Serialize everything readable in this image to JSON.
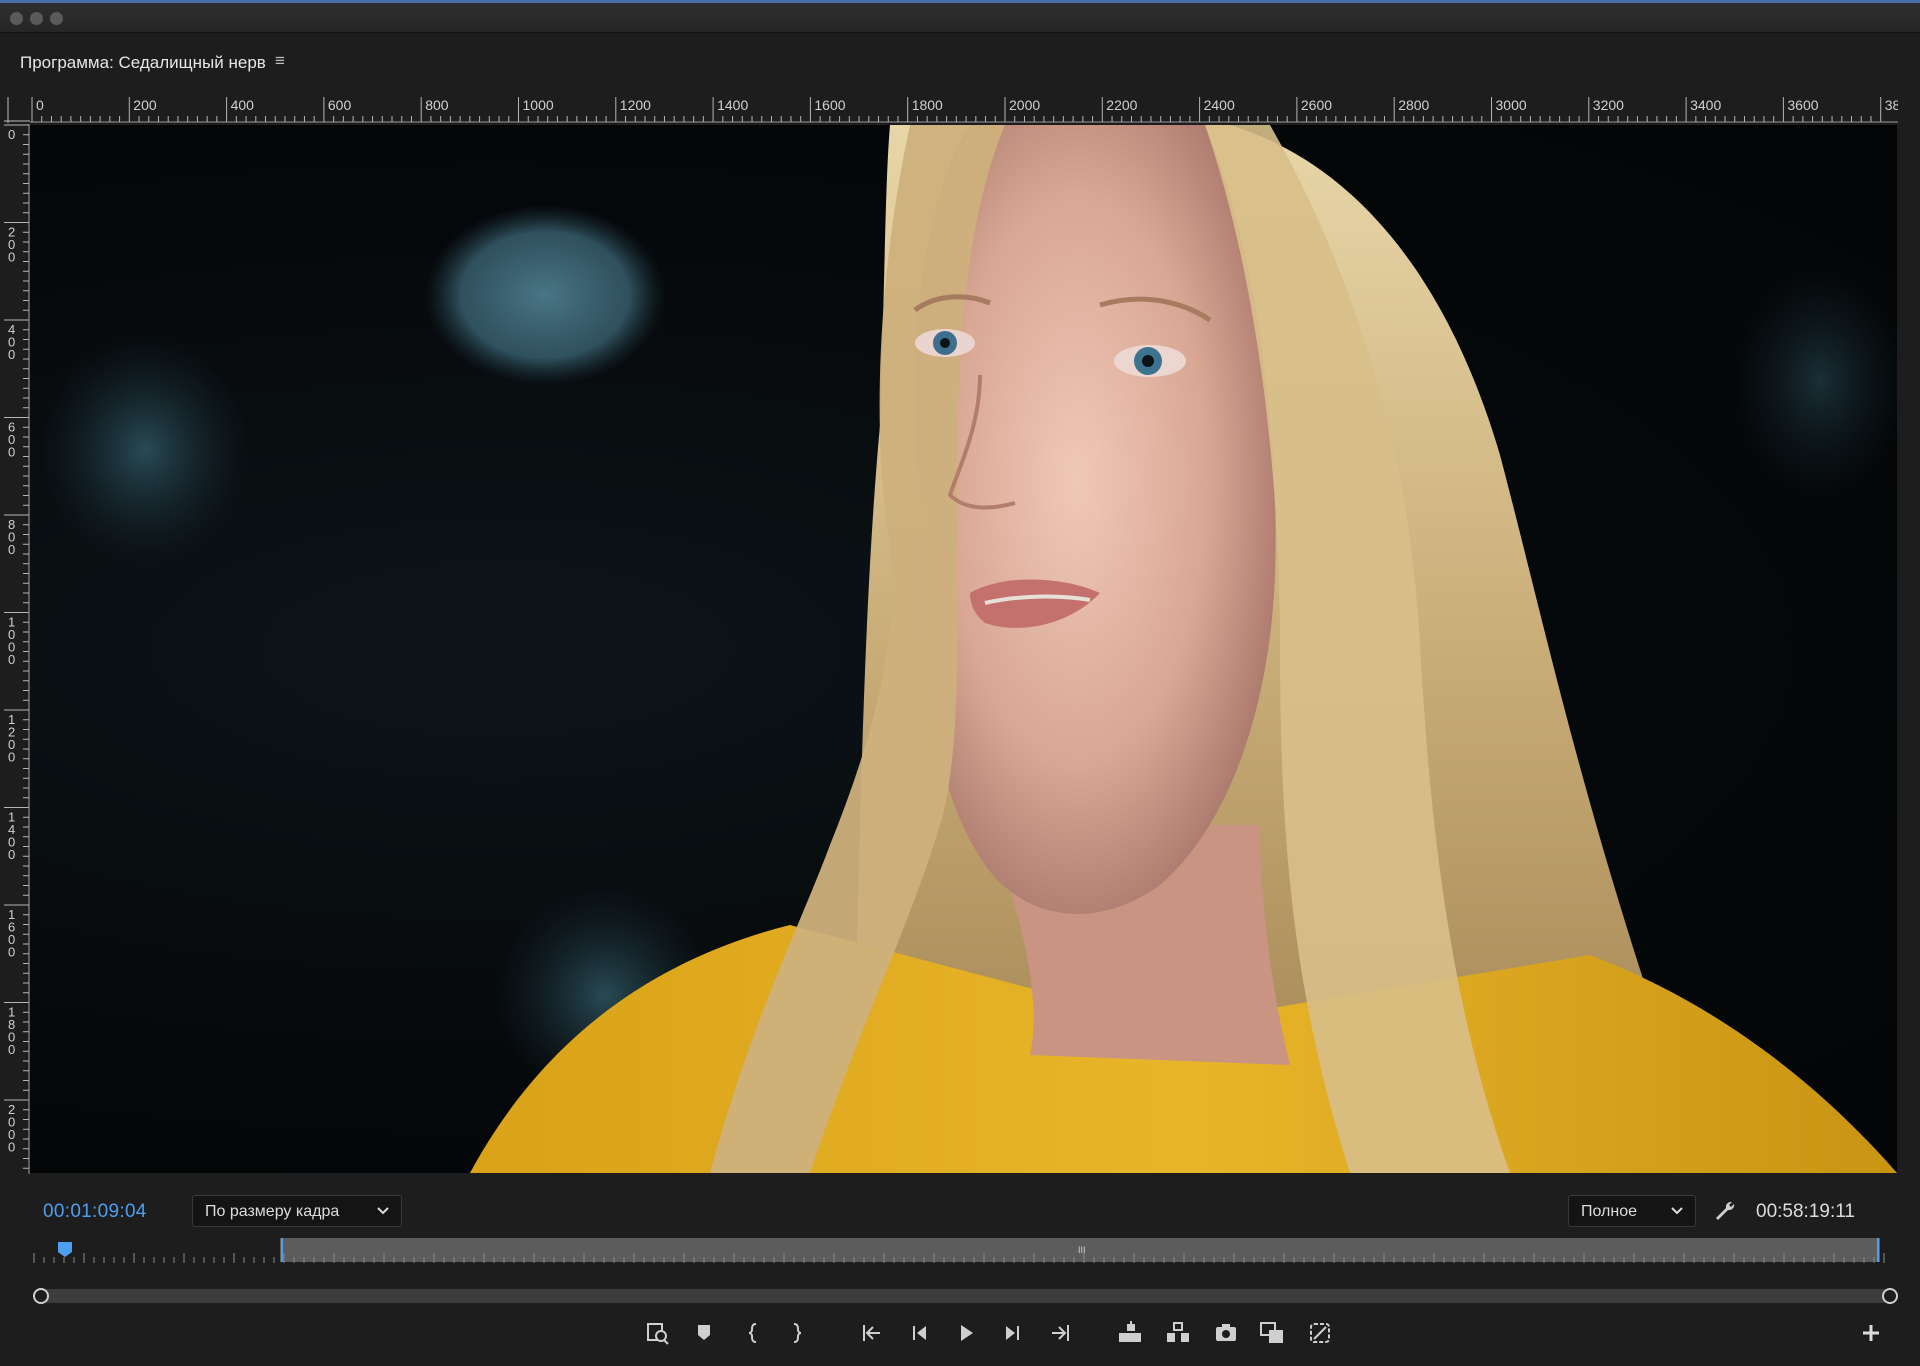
{
  "panel": {
    "title": "Программа: Седалищный нерв",
    "menu_icon": "hamburger-menu-icon"
  },
  "ruler": {
    "horizontal_labels": [
      "0",
      "200",
      "400",
      "600",
      "800",
      "1000",
      "1200",
      "1400",
      "1600",
      "1800",
      "2000",
      "2200",
      "2400",
      "2600",
      "2800",
      "3000",
      "3200",
      "3400",
      "3600",
      "38"
    ],
    "vertical_labels": [
      "0",
      "200",
      "400",
      "600",
      "800",
      "1000",
      "1200",
      "1400",
      "1600",
      "1800",
      "2000"
    ]
  },
  "playback": {
    "current_timecode": "00:01:09:04",
    "zoom_value": "По размеру кадра",
    "resolution_value": "Полное",
    "duration_timecode": "00:58:19:11",
    "settings_icon": "wrench-icon"
  },
  "transport": {
    "buttons": [
      "add-marker-search-icon",
      "marker-icon",
      "mark-in-icon",
      "mark-out-icon",
      "go-to-in-icon",
      "step-back-icon",
      "play-icon",
      "step-forward-icon",
      "go-to-out-icon",
      "lift-icon",
      "extract-icon",
      "export-frame-camera-icon",
      "comparison-view-icon",
      "vr-video-icon",
      "add-button-icon"
    ]
  },
  "colors": {
    "accent_blue": "#4d9ff0",
    "panel_bg": "#1d1d1d",
    "shirt_yellow": "#e2b020"
  }
}
